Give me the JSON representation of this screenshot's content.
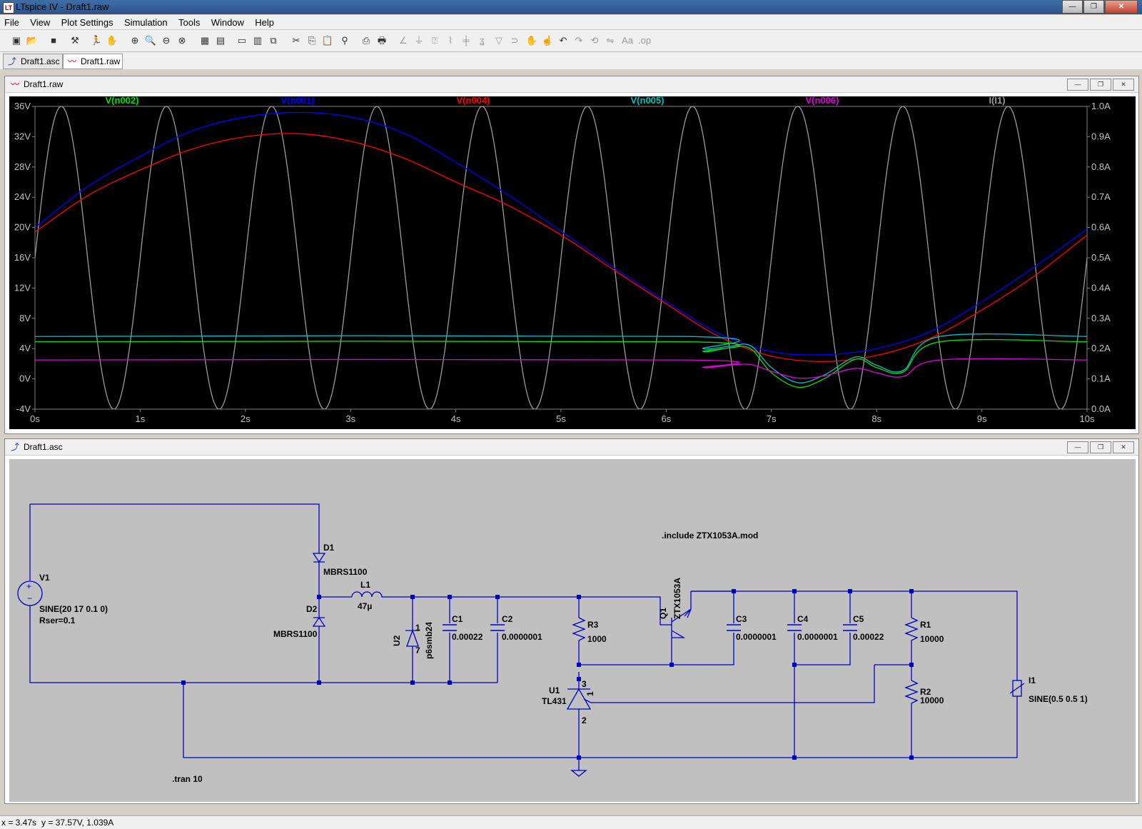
{
  "window": {
    "title": "LTspice IV - Draft1.raw",
    "app_icon": "LT",
    "minimize": "—",
    "maximize": "❐",
    "close": "✕"
  },
  "menu": {
    "items": [
      "File",
      "View",
      "Plot Settings",
      "Simulation",
      "Tools",
      "Window",
      "Help"
    ]
  },
  "toolbar": {
    "icons": [
      "new-schematic-icon",
      "open-icon",
      "save-icon",
      "control-panel-icon",
      "run-icon",
      "halt-icon",
      "zoom-in-icon",
      "zoom-area-icon",
      "zoom-out-icon",
      "zoom-cancel-icon",
      "autorange-icon",
      "full-view-icon",
      "tile-horizontal-icon",
      "tile-vertical-icon",
      "cascade-icon",
      "cut-icon",
      "copy-icon",
      "paste-icon",
      "find-icon",
      "print-setup-icon",
      "print-icon",
      "wire-icon",
      "ground-icon",
      "label-icon",
      "resistor-icon",
      "capacitor-icon",
      "inductor-icon",
      "diode-icon",
      "component-icon",
      "move-icon",
      "drag-icon",
      "undo-icon",
      "redo-icon",
      "rotate-icon",
      "mirror-icon",
      "text-icon",
      "spice-directive-icon"
    ]
  },
  "tabs": [
    {
      "label": "Draft1.asc"
    },
    {
      "label": "Draft1.raw"
    }
  ],
  "plot_window": {
    "title": "Draft1.raw"
  },
  "schematic_window": {
    "title": "Draft1.asc"
  },
  "chart_data": {
    "type": "line",
    "x": {
      "label": "",
      "range": [
        0,
        10
      ],
      "unit": "s",
      "ticks": [
        "0s",
        "1s",
        "2s",
        "3s",
        "4s",
        "5s",
        "6s",
        "7s",
        "8s",
        "9s",
        "10s"
      ]
    },
    "y_left": {
      "range": [
        -4,
        36
      ],
      "ticks": [
        "36V",
        "32V",
        "28V",
        "24V",
        "20V",
        "16V",
        "12V",
        "8V",
        "4V",
        "0V",
        "-4V"
      ]
    },
    "y_right": {
      "range": [
        0,
        1
      ],
      "ticks": [
        "1.0A",
        "0.9A",
        "0.8A",
        "0.7A",
        "0.6A",
        "0.5A",
        "0.4A",
        "0.3A",
        "0.2A",
        "0.1A",
        "0.0A"
      ]
    },
    "grid": false,
    "series": [
      {
        "name": "V(n002)",
        "color": "#00e000",
        "axis": "left",
        "x": [
          0,
          6.2,
          6.35,
          6.6,
          6.8,
          7.0,
          7.25,
          7.5,
          7.8,
          8.0,
          8.25,
          8.6,
          10
        ],
        "values": [
          4.9,
          4.9,
          3.6,
          4.1,
          4.0,
          0.8,
          -1.1,
          0.0,
          2.6,
          1.5,
          0.9,
          4.9,
          4.9
        ]
      },
      {
        "name": "V(n001)",
        "color": "#0000ff",
        "axis": "left",
        "x": [
          0,
          0.5,
          1,
          1.5,
          2,
          2.5,
          3,
          3.5,
          4,
          4.5,
          5,
          5.5,
          6,
          6.5,
          7,
          7.5,
          8,
          8.5,
          9,
          9.5,
          10
        ],
        "values": [
          20,
          25.4,
          29.4,
          32.8,
          34.6,
          35.2,
          34.6,
          32.5,
          28.6,
          24.3,
          19.5,
          14.7,
          10.2,
          6.0,
          3.6,
          3.2,
          4.0,
          6.2,
          10.2,
          14.8,
          19.8
        ]
      },
      {
        "name": "V(n004)",
        "color": "#ff0000",
        "axis": "left",
        "x": [
          0,
          0.5,
          1,
          1.5,
          2,
          2.5,
          3,
          3.5,
          4,
          4.5,
          5,
          5.5,
          6,
          6.5,
          7,
          7.5,
          8,
          8.5,
          9,
          9.5,
          10
        ],
        "values": [
          19.4,
          24.2,
          27.6,
          30.4,
          32.0,
          32.4,
          31.4,
          29.2,
          26.0,
          22.9,
          19.0,
          14.4,
          9.9,
          5.6,
          3.0,
          2.3,
          3.1,
          5.3,
          9.1,
          13.6,
          19.0
        ]
      },
      {
        "name": "V(n005)",
        "color": "#00c0c0",
        "axis": "left",
        "x": [
          0,
          6.2,
          6.35,
          6.6,
          6.8,
          7.0,
          7.25,
          7.5,
          7.8,
          8.0,
          8.25,
          8.6,
          10
        ],
        "values": [
          5.6,
          5.6,
          4.0,
          4.3,
          4.4,
          1.5,
          -0.5,
          0.5,
          2.9,
          1.8,
          1.1,
          5.6,
          5.6
        ]
      },
      {
        "name": "V(n006)",
        "color": "#e000e0",
        "axis": "left",
        "x": [
          0,
          6.2,
          6.35,
          6.6,
          6.8,
          7.0,
          7.25,
          7.5,
          7.8,
          8.0,
          8.25,
          8.6,
          10
        ],
        "values": [
          2.5,
          2.5,
          1.5,
          1.8,
          1.9,
          1.0,
          0.1,
          0.4,
          1.4,
          0.8,
          0.3,
          2.5,
          2.5
        ]
      },
      {
        "name": "I(I1)",
        "color": "#9a9a9a",
        "axis": "right",
        "function": "0.5+0.5*sin(2*pi*t)",
        "frequency": 1,
        "offset": 0.5,
        "amplitude": 0.5
      }
    ]
  },
  "schematic": {
    "labels": [
      {
        "id": "v1-name",
        "text": "V1"
      },
      {
        "id": "v1-value",
        "text": "SINE(20 17 0.1 0)"
      },
      {
        "id": "v1-rser",
        "text": "Rser=0.1"
      },
      {
        "id": "d1-name",
        "text": "D1"
      },
      {
        "id": "d1-value",
        "text": "MBRS1100"
      },
      {
        "id": "d2-name",
        "text": "D2"
      },
      {
        "id": "d2-value",
        "text": "MBRS1100"
      },
      {
        "id": "l1-name",
        "text": "L1"
      },
      {
        "id": "l1-value",
        "text": "47µ"
      },
      {
        "id": "u2-name",
        "text": "U2"
      },
      {
        "id": "u2-value",
        "text": "p6smb24"
      },
      {
        "id": "u2-pin1",
        "text": "1"
      },
      {
        "id": "u2-pin7",
        "text": "7"
      },
      {
        "id": "c1-name",
        "text": "C1"
      },
      {
        "id": "c1-value",
        "text": "0.00022"
      },
      {
        "id": "c2-name",
        "text": "C2"
      },
      {
        "id": "c2-value",
        "text": "0.0000001"
      },
      {
        "id": "r3-name",
        "text": "R3"
      },
      {
        "id": "r3-value",
        "text": "1000"
      },
      {
        "id": "q1-name",
        "text": "Q1"
      },
      {
        "id": "q1-value",
        "text": "ZTX1053A"
      },
      {
        "id": "c3-name",
        "text": "C3"
      },
      {
        "id": "c3-value",
        "text": "0.0000001"
      },
      {
        "id": "c4-name",
        "text": "C4"
      },
      {
        "id": "c4-value",
        "text": "0.0000001"
      },
      {
        "id": "c5-name",
        "text": "C5"
      },
      {
        "id": "c5-value",
        "text": "0.00022"
      },
      {
        "id": "r1-name",
        "text": "R1"
      },
      {
        "id": "r1-value",
        "text": "10000"
      },
      {
        "id": "r2-name",
        "text": "R2"
      },
      {
        "id": "r2-value",
        "text": "10000"
      },
      {
        "id": "u1-name",
        "text": "U1"
      },
      {
        "id": "u1-value",
        "text": "TL431"
      },
      {
        "id": "u1-pin3",
        "text": "3"
      },
      {
        "id": "u1-pin1",
        "text": "1"
      },
      {
        "id": "u1-pin2",
        "text": "2"
      },
      {
        "id": "i1-name",
        "text": "I1"
      },
      {
        "id": "i1-value",
        "text": "SINE(0.5 0.5 1)"
      },
      {
        "id": "include-directive",
        "text": ".include ZTX1053A.mod"
      },
      {
        "id": "tran-directive",
        "text": ".tran 10"
      }
    ]
  },
  "status": {
    "x": "x = 3.47s",
    "y": "y = 37.57V, 1.039A"
  },
  "colors": {
    "wire": "#0000c0",
    "schematic_bg": "#c0c0c0",
    "plot_bg": "#000000"
  }
}
